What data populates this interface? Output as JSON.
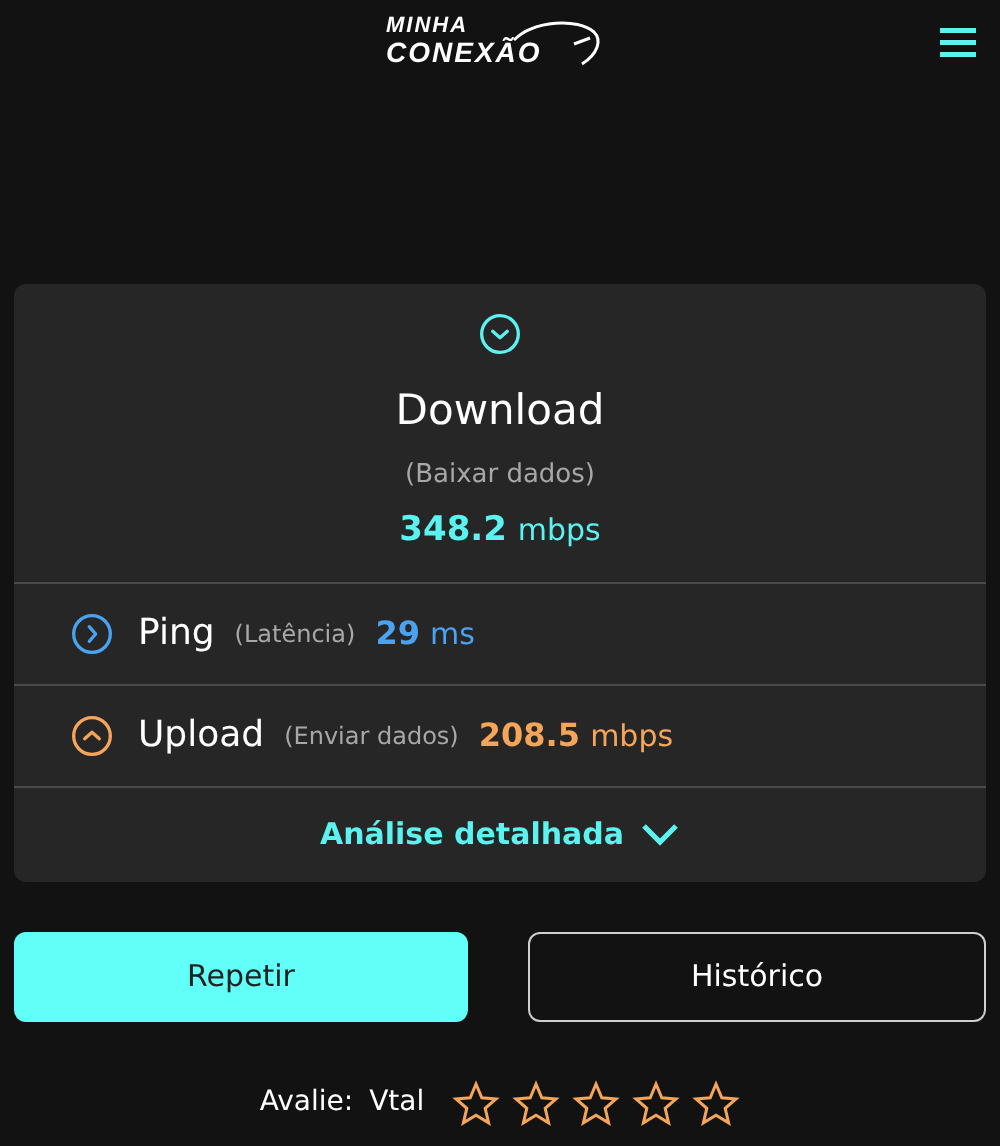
{
  "logo": {
    "line_1": "MINHA",
    "line_2": "CONEXÃO"
  },
  "download": {
    "title": "Download",
    "subtitle": "(Baixar dados)",
    "value": "348.2",
    "unit": "mbps",
    "color": "#5cf2f0"
  },
  "metrics": [
    {
      "kind": "ping",
      "title": "Ping",
      "subtitle": "(Latência)",
      "value": "29",
      "unit": "ms",
      "color": "#4aa3f0"
    },
    {
      "kind": "upload",
      "title": "Upload",
      "subtitle": "(Enviar dados)",
      "value": "208.5",
      "unit": "mbps",
      "color": "#f5a55a"
    }
  ],
  "details_link": {
    "label": "Análise detalhada",
    "expanded": false
  },
  "buttons": [
    {
      "label": "Repetir",
      "kind": "primary"
    },
    {
      "label": "Histórico",
      "kind": "outline"
    }
  ],
  "rating": {
    "label": "Avalie:",
    "provider": "Vtal",
    "stars": 0
  }
}
